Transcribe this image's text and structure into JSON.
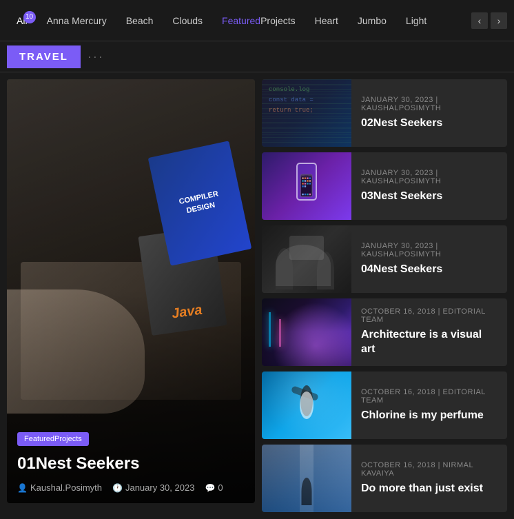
{
  "nav": {
    "tabs": [
      {
        "id": "all",
        "label": "All",
        "badge": "10",
        "active": true
      },
      {
        "id": "anna-mercury",
        "label": "Anna Mercury"
      },
      {
        "id": "beach",
        "label": "Beach"
      },
      {
        "id": "clouds",
        "label": "Clouds"
      },
      {
        "id": "featured-projects",
        "label": "FeaturedProjects",
        "highlighted": true
      },
      {
        "id": "heart",
        "label": "Heart"
      },
      {
        "id": "jumbo",
        "label": "Jumbo"
      },
      {
        "id": "light",
        "label": "Light"
      }
    ],
    "arrow_left": "‹",
    "arrow_right": "›"
  },
  "brand": {
    "label": "TRAVEL",
    "dots": "···"
  },
  "featured_post": {
    "tag": "FeaturedProjects",
    "title": "01Nest Seekers",
    "author": "Kaushal.Posimyth",
    "date": "January 30, 2023",
    "comments": "0"
  },
  "posts": [
    {
      "date": "January 30, 2023",
      "author": "KAUSHALPOSIMYTH",
      "title": "02Nest Seekers",
      "thumb_class": "thumb-dark-code"
    },
    {
      "date": "January 30, 2023",
      "author": "KAUSHALPOSIMYTH",
      "title": "03Nest Seekers",
      "thumb_class": "thumb-purple-phone"
    },
    {
      "date": "January 30, 2023",
      "author": "KAUSHALPOSIMYTH",
      "title": "04Nest Seekers",
      "thumb_class": "thumb-dark-people"
    },
    {
      "date": "October 16, 2018",
      "author": "EDITORIAL TEAM",
      "title": "Architecture is a visual art",
      "thumb_class": "thumb-neon-city"
    },
    {
      "date": "October 16, 2018",
      "author": "EDITORIAL TEAM",
      "title": "Chlorine is my perfume",
      "thumb_class": "thumb-blue-swim"
    },
    {
      "date": "October 16, 2018",
      "author": "NIRMAL KAVAIYA",
      "title": "Do more than just exist",
      "thumb_class": "thumb-waterfall"
    }
  ]
}
